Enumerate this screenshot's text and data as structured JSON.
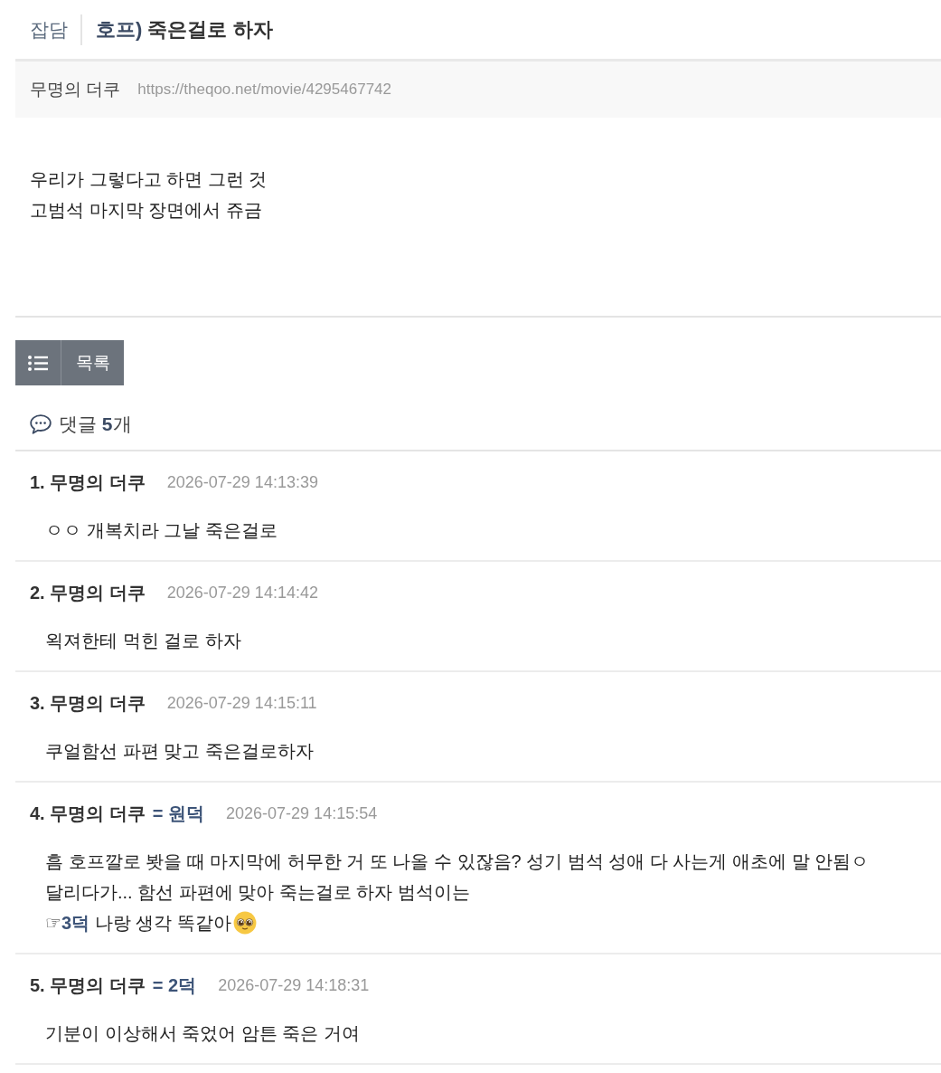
{
  "header": {
    "category": "잡담",
    "title_prefix": "호프)",
    "title": "죽은걸로 하자"
  },
  "meta": {
    "author": "무명의 더쿠",
    "url": "https://theqoo.net/movie/4295467742"
  },
  "post": {
    "lines": [
      "우리가 그렇다고 하면 그런 것",
      "고범석 마지막 장면에서 쥬금"
    ]
  },
  "list_button": {
    "label": "목록"
  },
  "comments_header": {
    "label": "댓글 **5**개"
  },
  "comments": [
    {
      "author": "1. 무명의 더쿠",
      "date": "2026-07-29 14:13:39",
      "lines": [
        {
          "text": "ㅇㅇ 개복치라 그날 죽은걸로"
        }
      ]
    },
    {
      "author": "2. 무명의 더쿠",
      "date": "2026-07-29 14:14:42",
      "lines": [
        {
          "text": "왹져한테 먹힌 걸로 하자"
        }
      ]
    },
    {
      "author": "3. 무명의 더쿠",
      "date": "2026-07-29 14:15:11",
      "lines": [
        {
          "text": "쿠얼함선 파편 맞고 죽은걸로하자"
        }
      ]
    },
    {
      "author": "4. 무명의 더쿠",
      "tag": "= 원덕",
      "date": "2026-07-29 14:15:54",
      "lines": [
        {
          "text": "흠 호프깔로 봣을 때 마지막에 허무한 거 또 나올 수 있잖음? 성기 범석 성애 다 사는게 애초에 말 안됨ㅇ"
        },
        {
          "text": "달리다가... 함선 파편에 맞아 죽는걸로 하자 범석이는"
        },
        {
          "text": "☞**3덕** 나랑 생각 똑같아",
          "emoji": true
        }
      ]
    },
    {
      "author": "5. 무명의 더쿠",
      "tag": "= 2덕",
      "date": "2026-07-29 14:18:31",
      "lines": [
        {
          "text": "기분이 이상해서 죽었어 암튼 죽은 거여"
        }
      ]
    }
  ]
}
